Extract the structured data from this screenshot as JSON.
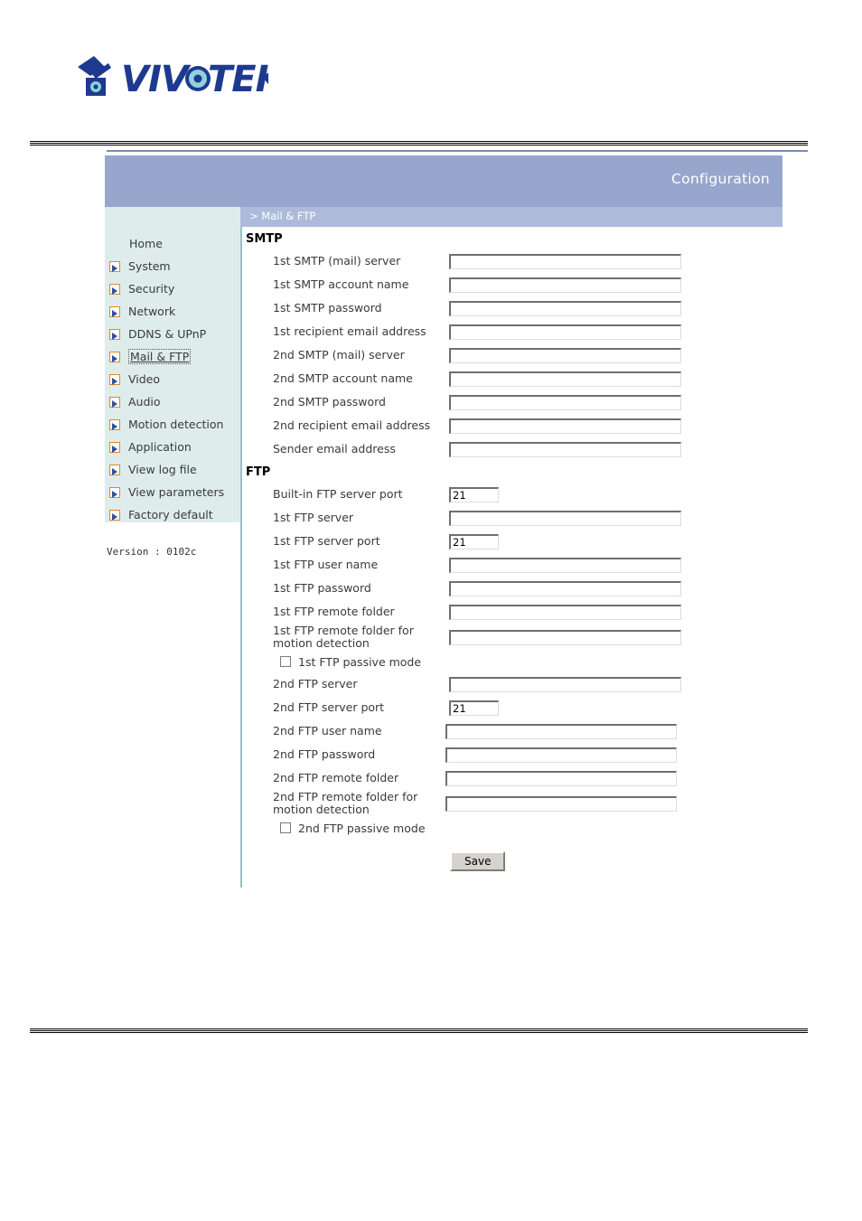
{
  "brand": {
    "name": "VIVOTEK",
    "logo_icon": "vivotek-camera-logo"
  },
  "window": {
    "title": "Configuration",
    "breadcrumb": "> Mail & FTP"
  },
  "sidebar": {
    "items": [
      {
        "label": "Home",
        "icon": "",
        "active": false
      },
      {
        "label": "System",
        "icon": "arrow-right-icon",
        "active": false
      },
      {
        "label": "Security",
        "icon": "arrow-right-icon",
        "active": false
      },
      {
        "label": "Network",
        "icon": "arrow-right-icon",
        "active": false
      },
      {
        "label": "DDNS & UPnP",
        "icon": "arrow-right-icon",
        "active": false
      },
      {
        "label": "Mail & FTP",
        "icon": "arrow-right-icon",
        "active": true
      },
      {
        "label": "Video",
        "icon": "arrow-right-icon",
        "active": false
      },
      {
        "label": "Audio",
        "icon": "arrow-right-icon",
        "active": false
      },
      {
        "label": "Motion detection",
        "icon": "arrow-right-icon",
        "active": false
      },
      {
        "label": "Application",
        "icon": "arrow-right-icon",
        "active": false
      },
      {
        "label": "View log file",
        "icon": "arrow-right-icon",
        "active": false
      },
      {
        "label": "View parameters",
        "icon": "arrow-right-icon",
        "active": false
      },
      {
        "label": "Factory default",
        "icon": "arrow-right-icon",
        "active": false
      }
    ],
    "version": "Version : 0102c"
  },
  "smtp": {
    "heading": "SMTP",
    "fields": [
      {
        "label": "1st SMTP (mail) server",
        "value": "",
        "placeholder": ""
      },
      {
        "label": "1st SMTP account name",
        "value": "",
        "placeholder": ""
      },
      {
        "label": "1st SMTP password",
        "value": "",
        "placeholder": ""
      },
      {
        "label": "1st recipient email address",
        "value": "",
        "placeholder": ""
      },
      {
        "label": "2nd SMTP (mail) server",
        "value": "",
        "placeholder": ""
      },
      {
        "label": "2nd SMTP account name",
        "value": "",
        "placeholder": ""
      },
      {
        "label": "2nd SMTP password",
        "value": "",
        "placeholder": ""
      },
      {
        "label": "2nd recipient email address",
        "value": "",
        "placeholder": ""
      },
      {
        "label": "Sender email address",
        "value": "",
        "placeholder": ""
      }
    ]
  },
  "ftp": {
    "heading": "FTP",
    "builtin": {
      "label": "Built-in FTP server port",
      "value": "21"
    },
    "first": {
      "server": {
        "label": "1st FTP server",
        "value": ""
      },
      "port": {
        "label": "1st FTP server port",
        "value": "21"
      },
      "user": {
        "label": "1st FTP user name",
        "value": ""
      },
      "password": {
        "label": "1st FTP password",
        "value": ""
      },
      "folder": {
        "label": "1st FTP remote folder",
        "value": ""
      },
      "folder_md": {
        "label": "1st FTP remote folder for motion detection",
        "value": ""
      },
      "passive": {
        "label": "1st FTP passive mode",
        "checked": false
      }
    },
    "second": {
      "server": {
        "label": "2nd FTP server",
        "value": ""
      },
      "port": {
        "label": "2nd FTP server port",
        "value": "21"
      },
      "user": {
        "label": "2nd FTP user name",
        "value": ""
      },
      "password": {
        "label": "2nd FTP password",
        "value": ""
      },
      "folder": {
        "label": "2nd FTP remote folder",
        "value": ""
      },
      "folder_md": {
        "label": "2nd FTP remote folder for motion detection",
        "value": ""
      },
      "passive": {
        "label": "2nd FTP passive mode",
        "checked": false
      }
    }
  },
  "actions": {
    "save_label": "Save"
  },
  "colors": {
    "titlebar": "#97a6cc",
    "breadcrumbbar": "#aebada",
    "sidebar_bg": "#dfecec",
    "divider": "#8fc4c4",
    "icon_border": "#e08a1e",
    "icon_arrow": "#2f4fa0"
  }
}
